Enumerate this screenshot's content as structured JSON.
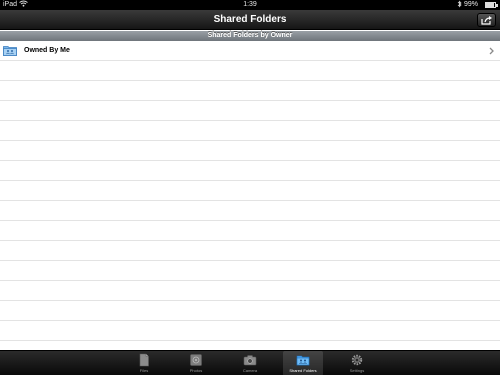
{
  "status_bar": {
    "carrier": "iPad",
    "time": "1:39",
    "battery": "99%"
  },
  "nav_bar": {
    "title": "Shared Folders",
    "action_icon": "share-icon"
  },
  "section": {
    "header": "Shared Folders by Owner"
  },
  "rows": [
    {
      "label": "Owned By Me",
      "icon": "shared-folder-icon"
    }
  ],
  "tabs": [
    {
      "label": "Files",
      "icon": "file-icon",
      "active": false
    },
    {
      "label": "Photos",
      "icon": "photo-icon",
      "active": false
    },
    {
      "label": "Camera",
      "icon": "camera-icon",
      "active": false
    },
    {
      "label": "Shared Folders",
      "icon": "shared-folder-icon",
      "active": true
    },
    {
      "label": "Settings",
      "icon": "gear-icon",
      "active": false
    }
  ],
  "colors": {
    "nav_bar": "#1f1f1f",
    "section_header": "#7f858b",
    "tab_active_label": "#ffffff",
    "tab_label": "#9a9a9a"
  }
}
